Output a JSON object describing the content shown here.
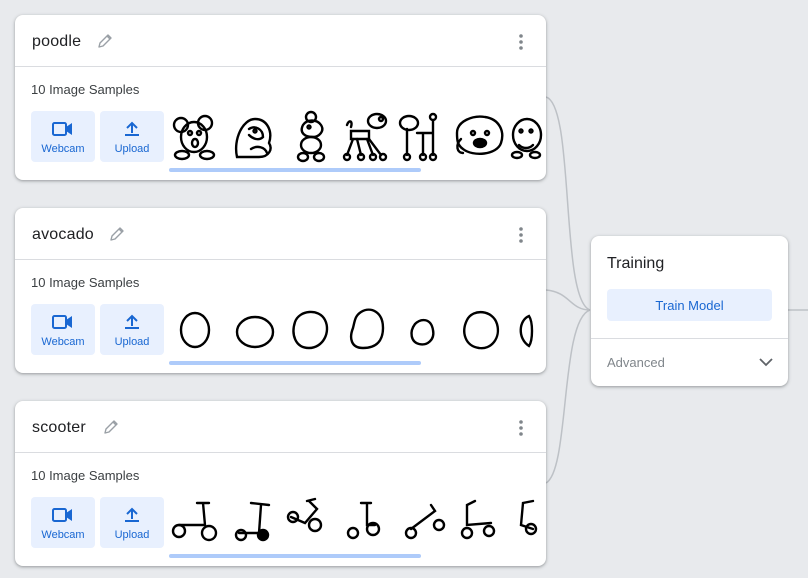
{
  "classes": [
    {
      "name": "poodle",
      "samples_label": "10 Image Samples",
      "webcam_label": "Webcam",
      "upload_label": "Upload"
    },
    {
      "name": "avocado",
      "samples_label": "10 Image Samples",
      "webcam_label": "Webcam",
      "upload_label": "Upload"
    },
    {
      "name": "scooter",
      "samples_label": "10 Image Samples",
      "webcam_label": "Webcam",
      "upload_label": "Upload"
    }
  ],
  "training": {
    "title": "Training",
    "train_button": "Train Model",
    "advanced_label": "Advanced"
  },
  "colors": {
    "accent": "#1967d2",
    "button_bg": "#e8f0fe",
    "scroll_bar": "#aecbfa",
    "background": "#e8eaed"
  },
  "icons": [
    "pencil-icon",
    "more-vert-icon",
    "webcam-icon",
    "upload-icon",
    "chevron-down-icon"
  ]
}
